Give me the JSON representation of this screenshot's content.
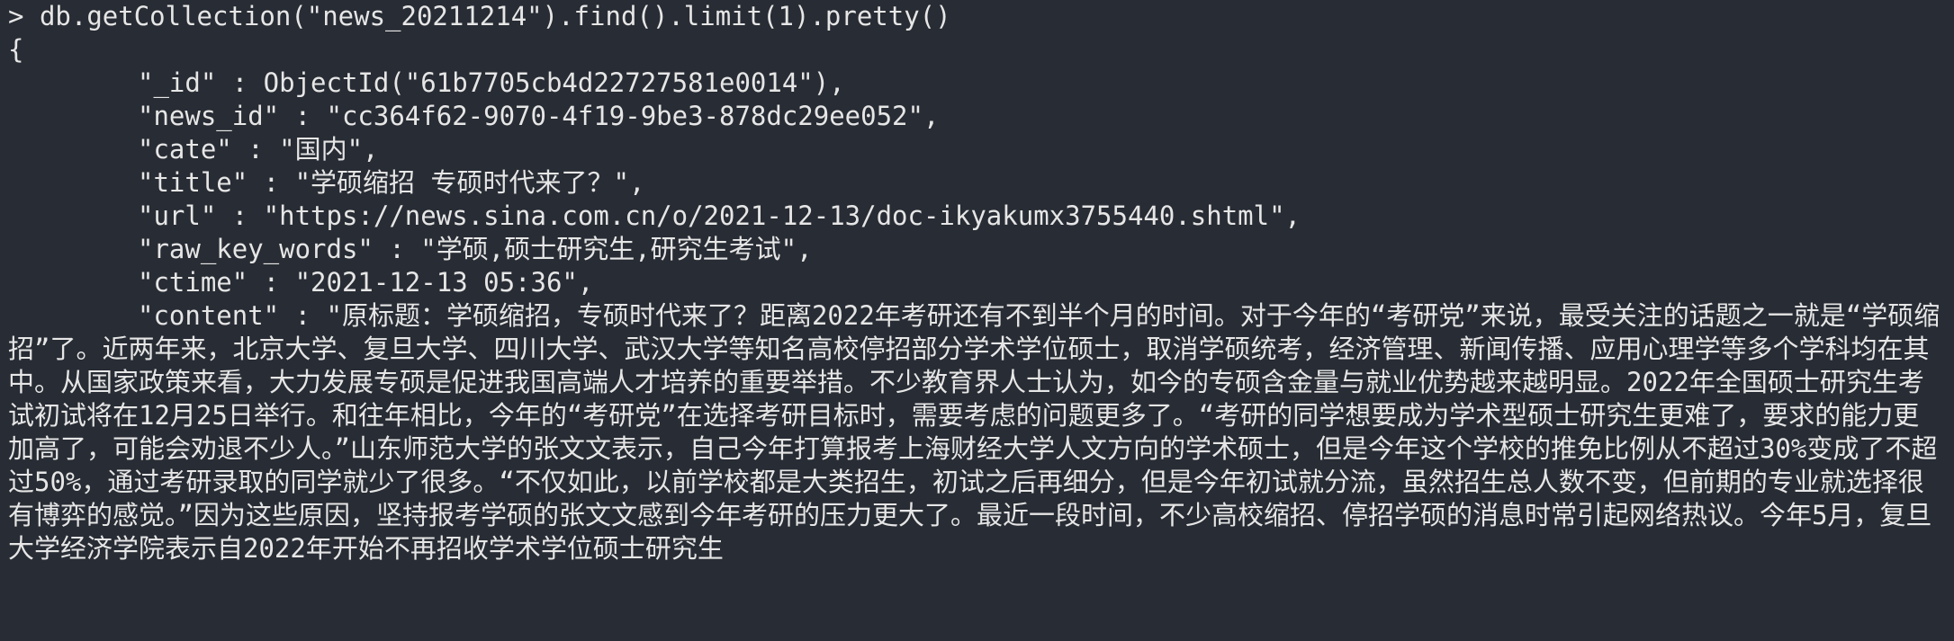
{
  "prompt": ">",
  "command": "db.getCollection(\"news_20211214\").find().limit(1).pretty()",
  "open_brace": "{",
  "fields": [
    {
      "text": "\"_id\" : ObjectId(\"61b7705cb4d22727581e0014\"),"
    },
    {
      "text": "\"news_id\" : \"cc364f62-9070-4f19-9be3-878dc29ee052\","
    },
    {
      "text": "\"cate\" : \"国内\","
    },
    {
      "text": "\"title\" : \"学硕缩招 专硕时代来了？\","
    },
    {
      "text": "\"url\" : \"https://news.sina.com.cn/o/2021-12-13/doc-ikyakumx3755440.shtml\","
    },
    {
      "text": "\"raw_key_words\" : \"学硕,硕士研究生,研究生考试\","
    },
    {
      "text": "\"ctime\" : \"2021-12-13 05:36\","
    }
  ],
  "content_text": "\"content\" : \"原标题：学硕缩招，专硕时代来了？距离2022年考研还有不到半个月的时间。对于今年的“考研党”来说，最受关注的话题之一就是“学硕缩招”了。近两年来，北京大学、复旦大学、四川大学、武汉大学等知名高校停招部分学术学位硕士，取消学硕统考，经济管理、新闻传播、应用心理学等多个学科均在其中。从国家政策来看，大力发展专硕是促进我国高端人才培养的重要举措。不少教育界人士认为，如今的专硕含金量与就业优势越来越明显。2022年全国硕士研究生考试初试将在12月25日举行。和往年相比，今年的“考研党”在选择考研目标时，需要考虑的问题更多了。“考研的同学想要成为学术型硕士研究生更难了，要求的能力更加高了，可能会劝退不少人。”山东师范大学的张文文表示，自己今年打算报考上海财经大学人文方向的学术硕士，但是今年这个学校的推免比例从不超过30%变成了不超过50%，通过考研录取的同学就少了很多。“不仅如此，以前学校都是大类招生，初试之后再细分，但是今年初试就分流，虽然招生总人数不变，但前期的专业就选择很有博弈的感觉。”因为这些原因，坚持报考学硕的张文文感到今年考研的压力更大了。最近一段时间，不少高校缩招、停招学硕的消息时常引起网络热议。今年5月，复旦大学经济学院表示自2022年开始不再招收学术学位硕士研究生",
  "colors": {
    "background": "#282c34",
    "foreground": "#e6e6e6"
  }
}
